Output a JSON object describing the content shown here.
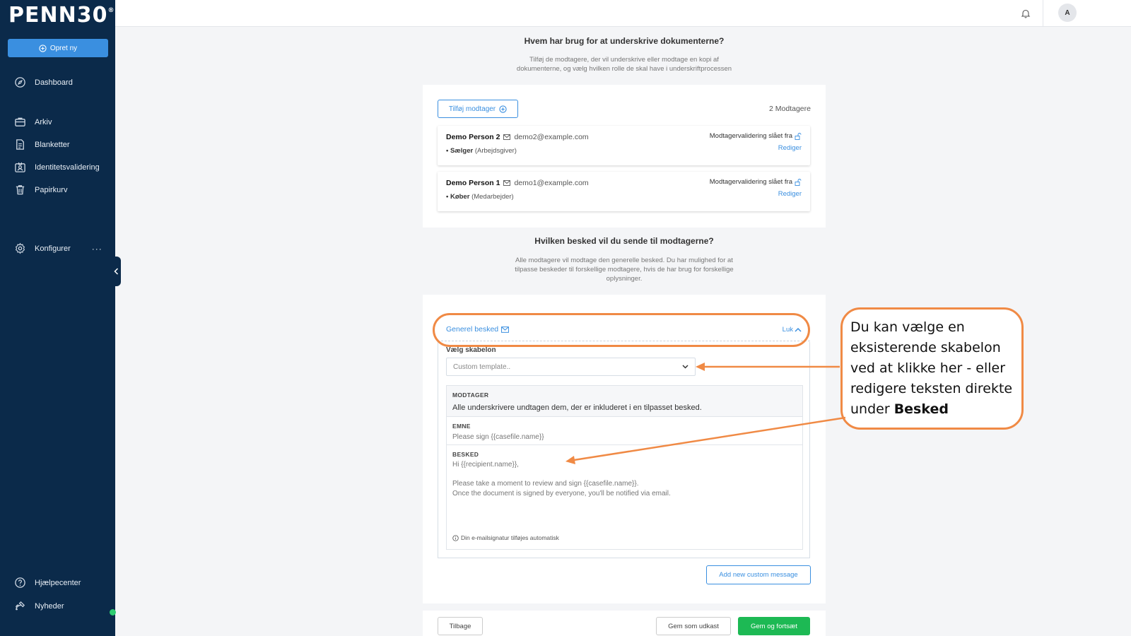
{
  "sidebar": {
    "logo": "PENN30",
    "logo_mark": "®",
    "create_label": "Opret ny",
    "items": [
      {
        "label": "Dashboard"
      },
      {
        "label": "Arkiv"
      },
      {
        "label": "Blanketter"
      },
      {
        "label": "Identitetsvalidering"
      },
      {
        "label": "Papirkurv"
      },
      {
        "label": "Konfigurer"
      },
      {
        "label": "Hjælpecenter"
      },
      {
        "label": "Nyheder"
      }
    ],
    "more": "···"
  },
  "topbar": {
    "avatar": "A"
  },
  "recipients_section": {
    "heading": "Hvem har brug for at underskrive dokumenterne?",
    "subtext_line1": "Tilføj de modtagere, der vil underskrive eller modtage en kopi af",
    "subtext_line2": "dokumenterne, og vælg hvilken rolle de skal have i underskriftprocessen",
    "add_label": "Tilføj modtager",
    "count": "2 Modtagere",
    "list": [
      {
        "name": "Demo Person 2",
        "email": "demo2@example.com",
        "role": "Sælger",
        "role_sub": "(Arbejdsgiver)",
        "validation": "Modtagervalidering slået fra",
        "edit": "Rediger"
      },
      {
        "name": "Demo Person 1",
        "email": "demo1@example.com",
        "role": "Køber",
        "role_sub": "(Medarbejder)",
        "validation": "Modtagervalidering slået fra",
        "edit": "Rediger"
      }
    ]
  },
  "message_section": {
    "heading": "Hvilken besked vil du sende til modtagerne?",
    "subtext_line1": "Alle modtagere vil modtage den generelle besked. Du har mulighed for at",
    "subtext_line2": "tilpasse beskeder til forskellige modtagere, hvis de har brug for forskellige",
    "subtext_line3": "oplysninger.",
    "general_label": "Generel besked",
    "close_label": "Luk",
    "template_label": "Vælg skabelon",
    "template_value": "Custom template..",
    "recipient_label": "MODTAGER",
    "recipient_value": "Alle underskrivere undtagen dem, der er inkluderet i en tilpasset besked.",
    "subject_label": "EMNE",
    "subject_value": "Please sign {{casefile.name}}",
    "body_label": "BESKED",
    "body_value": "Hi {{recipient.name}},\n\nPlease take a moment to review and sign {{casefile.name}}.\nOnce the document is signed by everyone, you'll be notified via email.",
    "signature_note": "Din e-mailsignatur tilføjes automatisk",
    "add_custom_label": "Add new custom message"
  },
  "footer": {
    "back": "Tilbage",
    "draft": "Gem som udkast",
    "continue": "Gem og fortsæt"
  },
  "annotation": {
    "text_1": "Du kan vælge en eksisterende skabelon ved at klikke her - eller redigere teksten direkte under ",
    "text_bold": "Besked"
  },
  "colors": {
    "sidebar_bg": "#0b2a4a",
    "accent": "#3a8fe0",
    "success": "#1db954",
    "annotation": "#f08a45"
  }
}
